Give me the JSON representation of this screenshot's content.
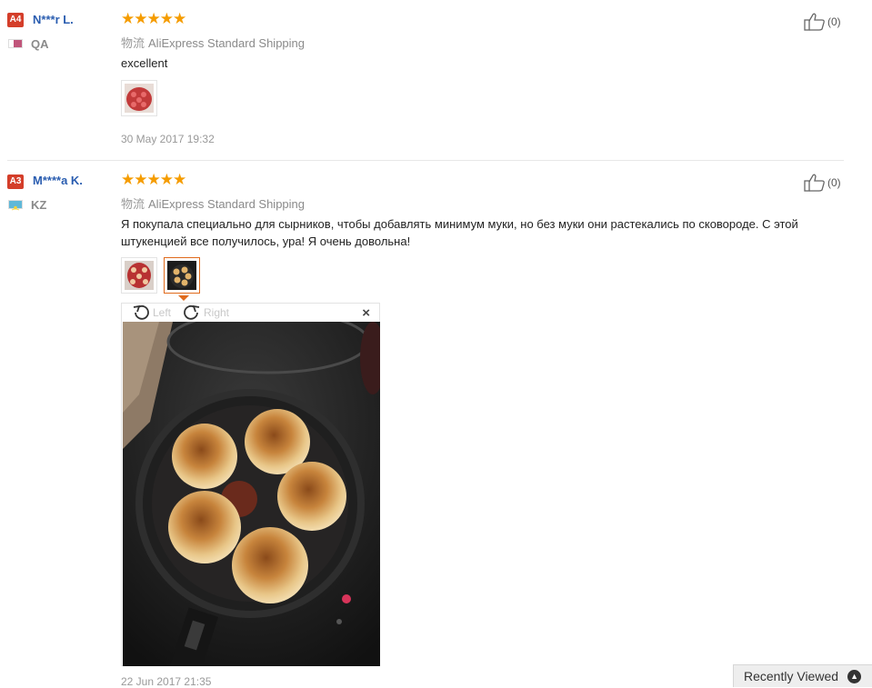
{
  "reviews": [
    {
      "level": "A4",
      "user": "N***r L.",
      "country": "QA",
      "stars": "★★★★★",
      "shipping_label": "物流",
      "shipping": "AliExpress Standard Shipping",
      "text": "excellent",
      "date": "30 May 2017 19:32",
      "helpful_count": "(0)"
    },
    {
      "level": "A3",
      "user": "M****a K.",
      "country": "KZ",
      "stars": "★★★★★",
      "shipping_label": "物流",
      "shipping": "AliExpress Standard Shipping",
      "text": "Я покупала специально для сырников, чтобы добавлять минимум муки, но без муки они растекались по сковороде. С этой штукенцией все получилось, ура! Я очень довольна!",
      "date": "22 Jun 2017 21:35",
      "helpful_count": "(0)"
    }
  ],
  "viewer": {
    "rotate_left": "Left",
    "rotate_right": "Right",
    "close": "×"
  },
  "recently_viewed": {
    "label": "Recently Viewed",
    "icon": "chevron-up-icon"
  },
  "colors": {
    "level_badge": "#d43e2a",
    "username": "#2a5db0",
    "stars": "#f59c00",
    "active_thumb": "#e06a1c"
  }
}
